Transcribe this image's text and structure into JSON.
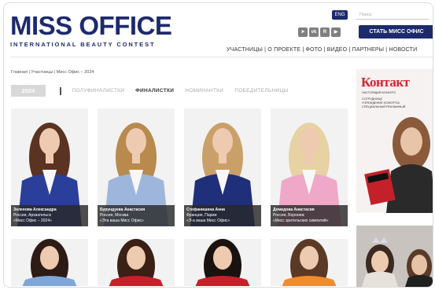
{
  "header": {
    "logo_main": "MISS OFFICE",
    "logo_sub": "INTERNATIONAL BEAUTY CONTEST",
    "lang": "ENG",
    "search_placeholder": "Поиск",
    "cta": "СТАТЬ МИСС ОФИС",
    "socials": [
      "telegram-icon",
      "vk-icon",
      "rutube-icon",
      "youtube-icon"
    ],
    "nav": "УЧАСТНИЦЫ  |  О ПРОЕКТЕ  |  ФОТО  |  ВИДЕО  |  ПАРТНЕРЫ  |  НОВОСТИ"
  },
  "breadcrumb": "Главная  |  Участницы  |  Мисс Офис – 2024",
  "tabs": {
    "year": "2024",
    "items": [
      "ПОЛУФИНАЛИСТКИ",
      "ФИНАЛИСТКИ",
      "НОМИНАНТКИ",
      "ПОБЕДИТЕЛЬНИЦЫ"
    ],
    "active": "ФИНАЛИСТКИ"
  },
  "participants": [
    {
      "name": "Зеленова Александра",
      "city": "Россия, Архангельск",
      "title": "«Мисс Офис – 2024»",
      "jacket": "#2a3f9a",
      "hair": "#5a3322"
    },
    {
      "name": "Бурундуева Анастасия",
      "city": "Россия, Москва",
      "title": "«Эта ваша Мисс Офис»",
      "jacket": "#9fb6dc",
      "hair": "#b98a4e"
    },
    {
      "name": "Стефанишина Анна",
      "city": "Франция, Париж",
      "title": "«Э-а ваша Мисс Офис»",
      "jacket": "#1f2f7a",
      "hair": "#caa06a"
    },
    {
      "name": "Демидова Анастасия",
      "city": "Россия, Воронеж",
      "title": "«Мисс зрительских симпатий»",
      "jacket": "#f0a8c8",
      "hair": "#e7d2a4"
    }
  ],
  "second_row": [
    {
      "jacket": "#7fa6d8",
      "hair": "#2d1c16"
    },
    {
      "jacket": "#c8202a",
      "hair": "#3a2015"
    },
    {
      "jacket": "#c8202a",
      "hair": "#1a120e"
    },
    {
      "jacket": "#f28b2a",
      "hair": "#5a3a24"
    }
  ],
  "sidebar_ad": {
    "title": "Контакт",
    "lines": [
      "НАСТОЯЩИЙ КОНКУРС",
      "СОТРУДНИЦЕ",
      "УЧРЕЖДЕНИЕ КОНКУРСА",
      "СПЕЦИАЛЬНЫЙ РЕКЛАМНЫЙ"
    ]
  },
  "colors": {
    "brand": "#1d2a6e",
    "accent": "#d3242f"
  }
}
